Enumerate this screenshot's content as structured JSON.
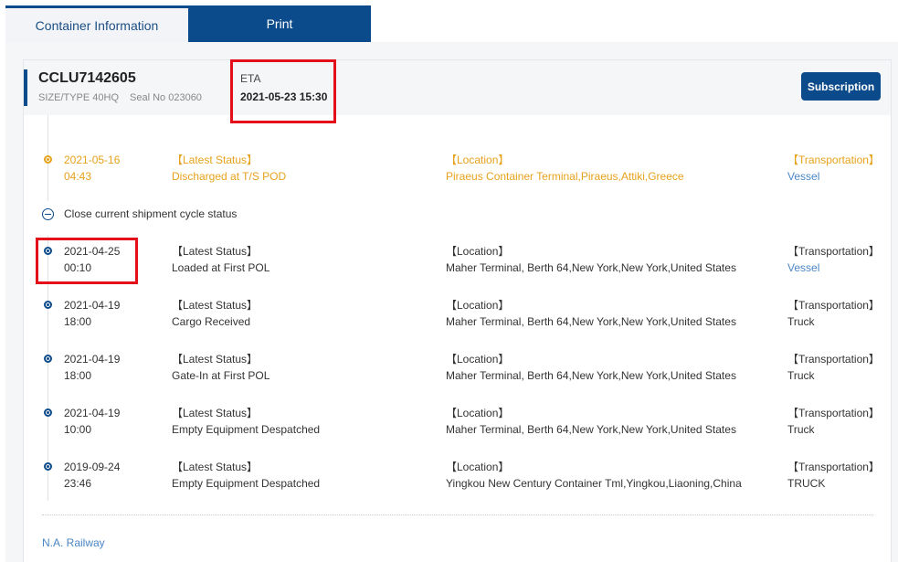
{
  "tabs": [
    {
      "label": "Container Information"
    },
    {
      "label": "Print"
    }
  ],
  "container": {
    "number": "CCLU7142605",
    "size_type": "SIZE/TYPE 40HQ",
    "seal": "Seal No 023060",
    "eta_label": "ETA",
    "eta_value": "2021-05-23 15:30",
    "subscription_label": "Subscription"
  },
  "latest_event": {
    "date": "2021-05-16",
    "time": "04:43",
    "status_label": "【Latest Status】",
    "status": "Discharged at T/S POD",
    "location_label": "【Location】",
    "location": "Piraeus Container Terminal,Piraeus,Attiki,Greece",
    "transport_label": "【Transportation】",
    "transport": "Vessel"
  },
  "collapse_label": "Close current shipment cycle status",
  "events": [
    {
      "date": "2021-04-25",
      "time": "00:10",
      "status_label": "【Latest Status】",
      "status": "Loaded at First POL",
      "location_label": "【Location】",
      "location": "Maher Terminal, Berth 64,New York,New York,United States",
      "transport_label": "【Transportation】",
      "transport": "Vessel"
    },
    {
      "date": "2021-04-19",
      "time": "18:00",
      "status_label": "【Latest Status】",
      "status": "Cargo Received",
      "location_label": "【Location】",
      "location": "Maher Terminal, Berth 64,New York,New York,United States",
      "transport_label": "【Transportation】",
      "transport": "Truck"
    },
    {
      "date": "2021-04-19",
      "time": "18:00",
      "status_label": "【Latest Status】",
      "status": "Gate-In at First POL",
      "location_label": "【Location】",
      "location": "Maher Terminal, Berth 64,New York,New York,United States",
      "transport_label": "【Transportation】",
      "transport": "Truck"
    },
    {
      "date": "2021-04-19",
      "time": "10:00",
      "status_label": "【Latest Status】",
      "status": "Empty Equipment Despatched",
      "location_label": "【Location】",
      "location": "Maher Terminal, Berth 64,New York,New York,United States",
      "transport_label": "【Transportation】",
      "transport": "Truck"
    },
    {
      "date": "2019-09-24",
      "time": "23:46",
      "status_label": "【Latest Status】",
      "status": "Empty Equipment Despatched",
      "location_label": "【Location】",
      "location": "Yingkou New Century Container Tml,Yingkou,Liaoning,China",
      "transport_label": "【Transportation】",
      "transport": "TRUCK"
    }
  ],
  "railway_label": "N.A. Railway",
  "colors": {
    "primary": "#0b4a8b",
    "latest": "#e6a21c",
    "link": "#4a86c5",
    "highlight": "#e3101a"
  }
}
